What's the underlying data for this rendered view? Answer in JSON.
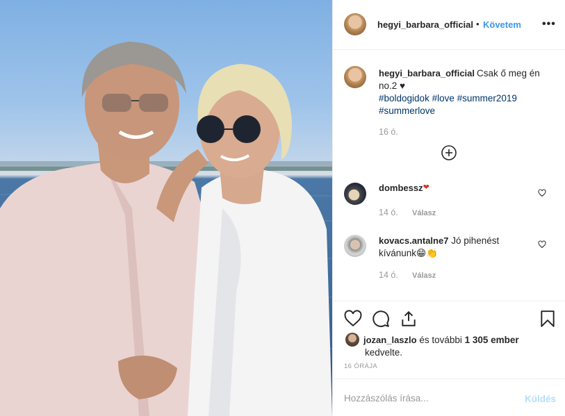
{
  "header": {
    "username": "hegyi_barbara_official",
    "separator": "•",
    "follow_label": "Követem",
    "more_label": "•••"
  },
  "caption": {
    "username": "hegyi_barbara_official",
    "text": "Csak ő meg én no.2 ♥",
    "hashtags": "#boldogidok #love #summer2019 #summerlove",
    "time": "16 ó."
  },
  "comments": [
    {
      "username": "dombessz",
      "text": "",
      "emoji": "heart",
      "time": "14 ó.",
      "reply_label": "Válasz"
    },
    {
      "username": "kovacs.antalne7",
      "text": "Jó pihenést kívánunk",
      "emoji": "grin,clap",
      "time": "14 ó.",
      "reply_label": "Válasz"
    }
  ],
  "likes": {
    "username": "jozan_laszlo",
    "text": " és további ",
    "count": "1 305 ember",
    "suffix": "kedvelte."
  },
  "post_date": "16 órája",
  "add_comment": {
    "placeholder": "Hozzászólás írása...",
    "send_label": "Küldés"
  },
  "colors": {
    "link_blue": "#3897f0",
    "hashtag": "#003569",
    "send_disabled": "#b2dffc",
    "muted": "#999999"
  },
  "icons": [
    "heart-outline-icon",
    "comment-icon",
    "share-icon",
    "bookmark-icon",
    "plus-circle-icon"
  ]
}
